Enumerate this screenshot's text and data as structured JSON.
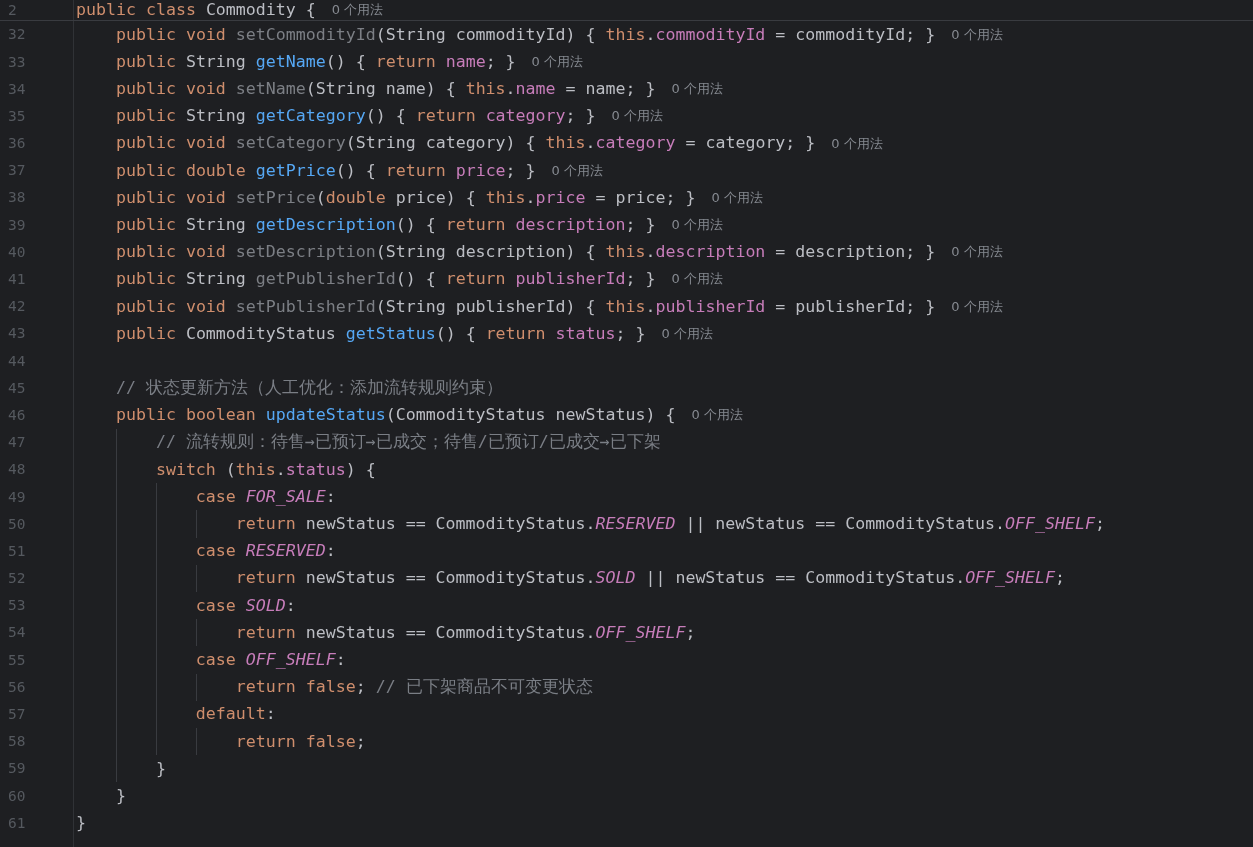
{
  "editor": {
    "sticky_line": {
      "number": "2",
      "tokens": [
        {
          "kind": "keyword",
          "text": "public class "
        },
        {
          "kind": "plain",
          "text": "Commodity {"
        }
      ],
      "hint": "0 个用法"
    },
    "lines": [
      {
        "number": "32",
        "tokens": [
          {
            "kind": "keyword",
            "text": "    public void "
          },
          {
            "kind": "unused_method",
            "text": "setCommodityId"
          },
          {
            "kind": "plain",
            "text": "(String commodityId) { "
          },
          {
            "kind": "keyword",
            "text": "this"
          },
          {
            "kind": "plain",
            "text": "."
          },
          {
            "kind": "field",
            "text": "commodityId"
          },
          {
            "kind": "plain",
            "text": " = commodityId; }"
          }
        ],
        "hint": "0 个用法"
      },
      {
        "number": "33",
        "tokens": [
          {
            "kind": "keyword",
            "text": "    public "
          },
          {
            "kind": "plain",
            "text": "String "
          },
          {
            "kind": "method",
            "text": "getName"
          },
          {
            "kind": "plain",
            "text": "() { "
          },
          {
            "kind": "keyword",
            "text": "return "
          },
          {
            "kind": "field",
            "text": "name"
          },
          {
            "kind": "plain",
            "text": "; }"
          }
        ],
        "hint": "0 个用法"
      },
      {
        "number": "34",
        "tokens": [
          {
            "kind": "keyword",
            "text": "    public void "
          },
          {
            "kind": "unused_method",
            "text": "setName"
          },
          {
            "kind": "plain",
            "text": "(String name) { "
          },
          {
            "kind": "keyword",
            "text": "this"
          },
          {
            "kind": "plain",
            "text": "."
          },
          {
            "kind": "field",
            "text": "name"
          },
          {
            "kind": "plain",
            "text": " = name; }"
          }
        ],
        "hint": "0 个用法"
      },
      {
        "number": "35",
        "tokens": [
          {
            "kind": "keyword",
            "text": "    public "
          },
          {
            "kind": "plain",
            "text": "String "
          },
          {
            "kind": "method",
            "text": "getCategory"
          },
          {
            "kind": "plain",
            "text": "() { "
          },
          {
            "kind": "keyword",
            "text": "return "
          },
          {
            "kind": "field",
            "text": "category"
          },
          {
            "kind": "plain",
            "text": "; }"
          }
        ],
        "hint": "0 个用法"
      },
      {
        "number": "36",
        "tokens": [
          {
            "kind": "keyword",
            "text": "    public void "
          },
          {
            "kind": "unused_method",
            "text": "setCategory"
          },
          {
            "kind": "plain",
            "text": "(String category) { "
          },
          {
            "kind": "keyword",
            "text": "this"
          },
          {
            "kind": "plain",
            "text": "."
          },
          {
            "kind": "field",
            "text": "category"
          },
          {
            "kind": "plain",
            "text": " = category; }"
          }
        ],
        "hint": "0 个用法"
      },
      {
        "number": "37",
        "tokens": [
          {
            "kind": "keyword",
            "text": "    public double "
          },
          {
            "kind": "method",
            "text": "getPrice"
          },
          {
            "kind": "plain",
            "text": "() { "
          },
          {
            "kind": "keyword",
            "text": "return "
          },
          {
            "kind": "field",
            "text": "price"
          },
          {
            "kind": "plain",
            "text": "; }"
          }
        ],
        "hint": "0 个用法"
      },
      {
        "number": "38",
        "tokens": [
          {
            "kind": "keyword",
            "text": "    public void "
          },
          {
            "kind": "unused_method",
            "text": "setPrice"
          },
          {
            "kind": "plain",
            "text": "("
          },
          {
            "kind": "keyword",
            "text": "double"
          },
          {
            "kind": "plain",
            "text": " price) { "
          },
          {
            "kind": "keyword",
            "text": "this"
          },
          {
            "kind": "plain",
            "text": "."
          },
          {
            "kind": "field",
            "text": "price"
          },
          {
            "kind": "plain",
            "text": " = price; }"
          }
        ],
        "hint": "0 个用法"
      },
      {
        "number": "39",
        "tokens": [
          {
            "kind": "keyword",
            "text": "    public "
          },
          {
            "kind": "plain",
            "text": "String "
          },
          {
            "kind": "method",
            "text": "getDescription"
          },
          {
            "kind": "plain",
            "text": "() { "
          },
          {
            "kind": "keyword",
            "text": "return "
          },
          {
            "kind": "field",
            "text": "description"
          },
          {
            "kind": "plain",
            "text": "; }"
          }
        ],
        "hint": "0 个用法"
      },
      {
        "number": "40",
        "tokens": [
          {
            "kind": "keyword",
            "text": "    public void "
          },
          {
            "kind": "unused_method",
            "text": "setDescription"
          },
          {
            "kind": "plain",
            "text": "(String description) { "
          },
          {
            "kind": "keyword",
            "text": "this"
          },
          {
            "kind": "plain",
            "text": "."
          },
          {
            "kind": "field",
            "text": "description"
          },
          {
            "kind": "plain",
            "text": " = description; }"
          }
        ],
        "hint": "0 个用法"
      },
      {
        "number": "41",
        "tokens": [
          {
            "kind": "keyword",
            "text": "    public "
          },
          {
            "kind": "plain",
            "text": "String "
          },
          {
            "kind": "unused_method",
            "text": "getPublisherId"
          },
          {
            "kind": "plain",
            "text": "() { "
          },
          {
            "kind": "keyword",
            "text": "return "
          },
          {
            "kind": "field",
            "text": "publisherId"
          },
          {
            "kind": "plain",
            "text": "; }"
          }
        ],
        "hint": "0 个用法"
      },
      {
        "number": "42",
        "tokens": [
          {
            "kind": "keyword",
            "text": "    public void "
          },
          {
            "kind": "unused_method",
            "text": "setPublisherId"
          },
          {
            "kind": "plain",
            "text": "(String publisherId) { "
          },
          {
            "kind": "keyword",
            "text": "this"
          },
          {
            "kind": "plain",
            "text": "."
          },
          {
            "kind": "field",
            "text": "publisherId"
          },
          {
            "kind": "plain",
            "text": " = publisherId; }"
          }
        ],
        "hint": "0 个用法"
      },
      {
        "number": "43",
        "tokens": [
          {
            "kind": "keyword",
            "text": "    public "
          },
          {
            "kind": "plain",
            "text": "CommodityStatus "
          },
          {
            "kind": "method",
            "text": "getStatus"
          },
          {
            "kind": "plain",
            "text": "() { "
          },
          {
            "kind": "keyword",
            "text": "return "
          },
          {
            "kind": "field",
            "text": "status"
          },
          {
            "kind": "plain",
            "text": "; }"
          }
        ],
        "hint": "0 个用法"
      },
      {
        "number": "44"
      },
      {
        "number": "45",
        "tokens": [
          {
            "kind": "comment",
            "text": "    // 状态更新方法（人工优化：添加流转规则约束）"
          }
        ]
      },
      {
        "number": "46",
        "tokens": [
          {
            "kind": "keyword",
            "text": "    public boolean "
          },
          {
            "kind": "method",
            "text": "updateStatus"
          },
          {
            "kind": "plain",
            "text": "(CommodityStatus newStatus) {"
          }
        ],
        "hint": "0 个用法"
      },
      {
        "number": "47",
        "tokens": [
          {
            "kind": "comment",
            "text": "        // 流转规则：待售→已预订→已成交；待售/已预订/已成交→已下架"
          }
        ]
      },
      {
        "number": "48",
        "tokens": [
          {
            "kind": "keyword",
            "text": "        switch "
          },
          {
            "kind": "plain",
            "text": "("
          },
          {
            "kind": "keyword",
            "text": "this"
          },
          {
            "kind": "plain",
            "text": "."
          },
          {
            "kind": "field",
            "text": "status"
          },
          {
            "kind": "plain",
            "text": ") {"
          }
        ]
      },
      {
        "number": "49",
        "tokens": [
          {
            "kind": "keyword",
            "text": "            case "
          },
          {
            "kind": "constant",
            "text": "FOR_SALE"
          },
          {
            "kind": "plain",
            "text": ":"
          }
        ]
      },
      {
        "number": "50",
        "tokens": [
          {
            "kind": "keyword",
            "text": "                return "
          },
          {
            "kind": "plain",
            "text": "newStatus == CommodityStatus."
          },
          {
            "kind": "constant",
            "text": "RESERVED"
          },
          {
            "kind": "plain",
            "text": " || newStatus == CommodityStatus."
          },
          {
            "kind": "constant",
            "text": "OFF_SHELF"
          },
          {
            "kind": "plain",
            "text": ";"
          }
        ]
      },
      {
        "number": "51",
        "tokens": [
          {
            "kind": "keyword",
            "text": "            case "
          },
          {
            "kind": "constant",
            "text": "RESERVED"
          },
          {
            "kind": "plain",
            "text": ":"
          }
        ]
      },
      {
        "number": "52",
        "tokens": [
          {
            "kind": "keyword",
            "text": "                return "
          },
          {
            "kind": "plain",
            "text": "newStatus == CommodityStatus."
          },
          {
            "kind": "constant",
            "text": "SOLD"
          },
          {
            "kind": "plain",
            "text": " || newStatus == CommodityStatus."
          },
          {
            "kind": "constant",
            "text": "OFF_SHELF"
          },
          {
            "kind": "plain",
            "text": ";"
          }
        ]
      },
      {
        "number": "53",
        "tokens": [
          {
            "kind": "keyword",
            "text": "            case "
          },
          {
            "kind": "constant",
            "text": "SOLD"
          },
          {
            "kind": "plain",
            "text": ":"
          }
        ]
      },
      {
        "number": "54",
        "tokens": [
          {
            "kind": "keyword",
            "text": "                return "
          },
          {
            "kind": "plain",
            "text": "newStatus == CommodityStatus."
          },
          {
            "kind": "constant",
            "text": "OFF_SHELF"
          },
          {
            "kind": "plain",
            "text": ";"
          }
        ]
      },
      {
        "number": "55",
        "tokens": [
          {
            "kind": "keyword",
            "text": "            case "
          },
          {
            "kind": "constant",
            "text": "OFF_SHELF"
          },
          {
            "kind": "plain",
            "text": ":"
          }
        ]
      },
      {
        "number": "56",
        "tokens": [
          {
            "kind": "keyword",
            "text": "                return false"
          },
          {
            "kind": "plain",
            "text": "; "
          },
          {
            "kind": "comment",
            "text": "// 已下架商品不可变更状态"
          }
        ]
      },
      {
        "number": "57",
        "tokens": [
          {
            "kind": "keyword",
            "text": "            default"
          },
          {
            "kind": "plain",
            "text": ":"
          }
        ]
      },
      {
        "number": "58",
        "tokens": [
          {
            "kind": "keyword",
            "text": "                return false"
          },
          {
            "kind": "plain",
            "text": ";"
          }
        ]
      },
      {
        "number": "59",
        "tokens": [
          {
            "kind": "plain",
            "text": "        }"
          }
        ]
      },
      {
        "number": "60",
        "tokens": [
          {
            "kind": "plain",
            "text": "    }"
          }
        ]
      },
      {
        "number": "61",
        "tokens": [
          {
            "kind": "plain",
            "text": "}"
          }
        ]
      }
    ]
  }
}
